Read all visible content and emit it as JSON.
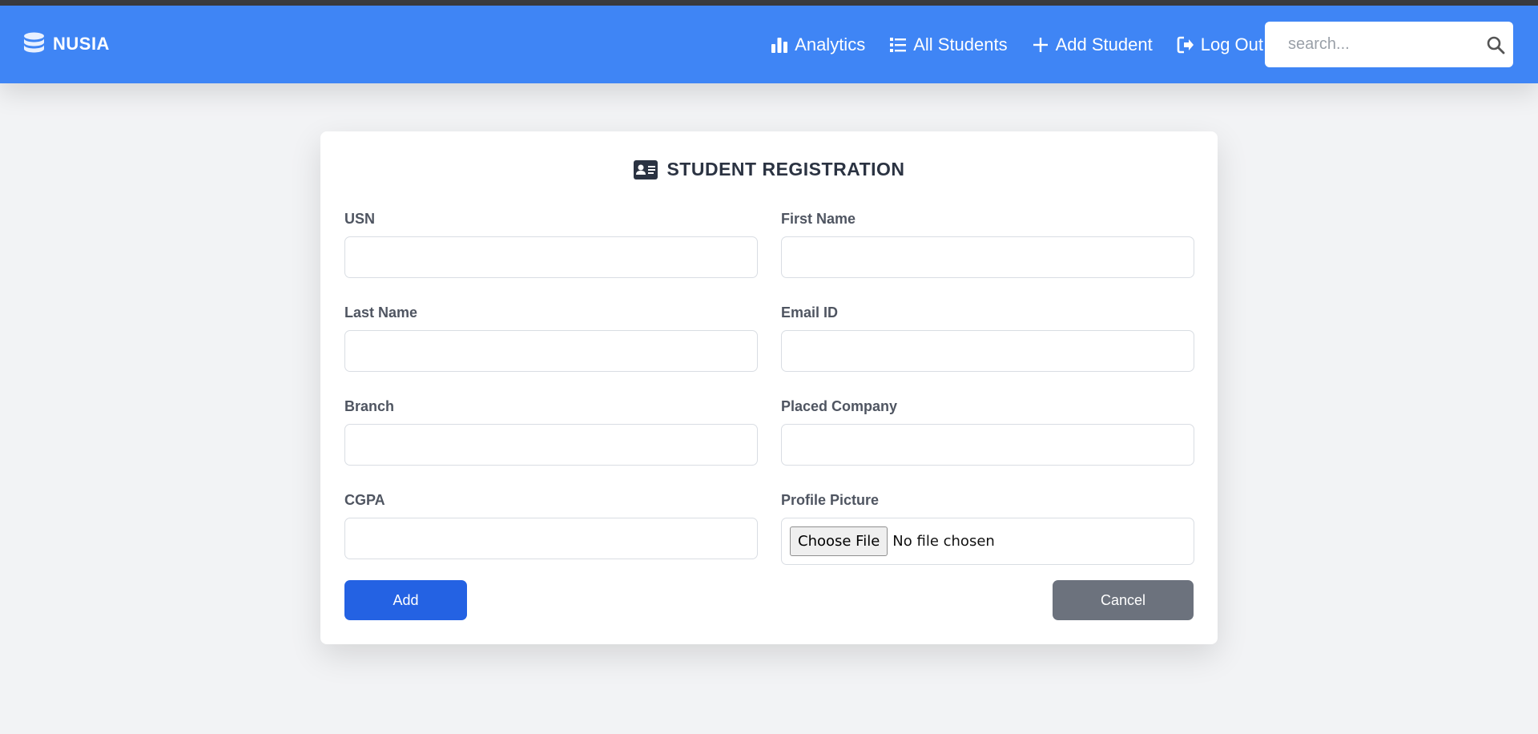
{
  "navbar": {
    "brand": "NUSIA",
    "links": [
      {
        "label": "Analytics",
        "icon": "bar-chart-icon"
      },
      {
        "label": "All Students",
        "icon": "list-icon"
      },
      {
        "label": "Add Student",
        "icon": "plus-icon"
      },
      {
        "label": "Log Out",
        "icon": "logout-icon"
      }
    ],
    "search": {
      "placeholder": "search...",
      "value": ""
    }
  },
  "form": {
    "title": "STUDENT REGISTRATION",
    "fields": {
      "usn": {
        "label": "USN",
        "value": ""
      },
      "first_name": {
        "label": "First Name",
        "value": ""
      },
      "last_name": {
        "label": "Last Name",
        "value": ""
      },
      "email": {
        "label": "Email ID",
        "value": ""
      },
      "branch": {
        "label": "Branch",
        "value": ""
      },
      "placed_company": {
        "label": "Placed Company",
        "value": ""
      },
      "cgpa": {
        "label": "CGPA",
        "value": ""
      },
      "profile_picture": {
        "label": "Profile Picture",
        "button": "Choose File",
        "status": "No file chosen"
      }
    },
    "add_label": "Add",
    "cancel_label": "Cancel"
  },
  "colors": {
    "navbar": "#3f85f5",
    "primary_button": "#2462e3",
    "secondary_button": "#6c727d",
    "page_background": "#f2f3f5"
  }
}
